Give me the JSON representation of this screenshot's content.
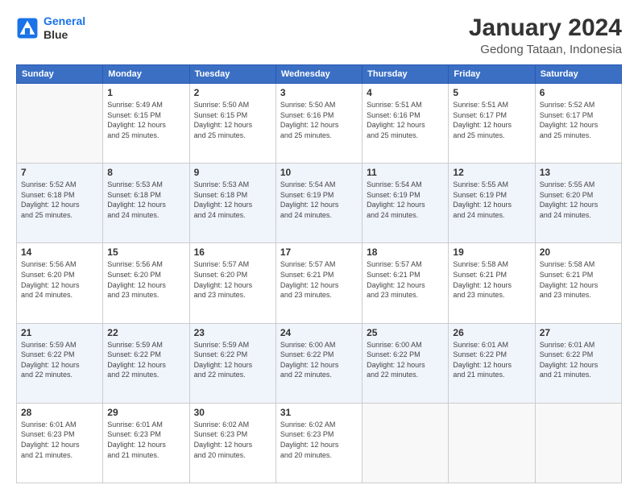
{
  "header": {
    "logo_line1": "General",
    "logo_line2": "Blue",
    "title": "January 2024",
    "subtitle": "Gedong Tataan, Indonesia"
  },
  "days_of_week": [
    "Sunday",
    "Monday",
    "Tuesday",
    "Wednesday",
    "Thursday",
    "Friday",
    "Saturday"
  ],
  "weeks": [
    [
      {
        "day": "",
        "info": ""
      },
      {
        "day": "1",
        "info": "Sunrise: 5:49 AM\nSunset: 6:15 PM\nDaylight: 12 hours\nand 25 minutes."
      },
      {
        "day": "2",
        "info": "Sunrise: 5:50 AM\nSunset: 6:15 PM\nDaylight: 12 hours\nand 25 minutes."
      },
      {
        "day": "3",
        "info": "Sunrise: 5:50 AM\nSunset: 6:16 PM\nDaylight: 12 hours\nand 25 minutes."
      },
      {
        "day": "4",
        "info": "Sunrise: 5:51 AM\nSunset: 6:16 PM\nDaylight: 12 hours\nand 25 minutes."
      },
      {
        "day": "5",
        "info": "Sunrise: 5:51 AM\nSunset: 6:17 PM\nDaylight: 12 hours\nand 25 minutes."
      },
      {
        "day": "6",
        "info": "Sunrise: 5:52 AM\nSunset: 6:17 PM\nDaylight: 12 hours\nand 25 minutes."
      }
    ],
    [
      {
        "day": "7",
        "info": "Sunrise: 5:52 AM\nSunset: 6:18 PM\nDaylight: 12 hours\nand 25 minutes."
      },
      {
        "day": "8",
        "info": "Sunrise: 5:53 AM\nSunset: 6:18 PM\nDaylight: 12 hours\nand 24 minutes."
      },
      {
        "day": "9",
        "info": "Sunrise: 5:53 AM\nSunset: 6:18 PM\nDaylight: 12 hours\nand 24 minutes."
      },
      {
        "day": "10",
        "info": "Sunrise: 5:54 AM\nSunset: 6:19 PM\nDaylight: 12 hours\nand 24 minutes."
      },
      {
        "day": "11",
        "info": "Sunrise: 5:54 AM\nSunset: 6:19 PM\nDaylight: 12 hours\nand 24 minutes."
      },
      {
        "day": "12",
        "info": "Sunrise: 5:55 AM\nSunset: 6:19 PM\nDaylight: 12 hours\nand 24 minutes."
      },
      {
        "day": "13",
        "info": "Sunrise: 5:55 AM\nSunset: 6:20 PM\nDaylight: 12 hours\nand 24 minutes."
      }
    ],
    [
      {
        "day": "14",
        "info": "Sunrise: 5:56 AM\nSunset: 6:20 PM\nDaylight: 12 hours\nand 24 minutes."
      },
      {
        "day": "15",
        "info": "Sunrise: 5:56 AM\nSunset: 6:20 PM\nDaylight: 12 hours\nand 23 minutes."
      },
      {
        "day": "16",
        "info": "Sunrise: 5:57 AM\nSunset: 6:20 PM\nDaylight: 12 hours\nand 23 minutes."
      },
      {
        "day": "17",
        "info": "Sunrise: 5:57 AM\nSunset: 6:21 PM\nDaylight: 12 hours\nand 23 minutes."
      },
      {
        "day": "18",
        "info": "Sunrise: 5:57 AM\nSunset: 6:21 PM\nDaylight: 12 hours\nand 23 minutes."
      },
      {
        "day": "19",
        "info": "Sunrise: 5:58 AM\nSunset: 6:21 PM\nDaylight: 12 hours\nand 23 minutes."
      },
      {
        "day": "20",
        "info": "Sunrise: 5:58 AM\nSunset: 6:21 PM\nDaylight: 12 hours\nand 23 minutes."
      }
    ],
    [
      {
        "day": "21",
        "info": "Sunrise: 5:59 AM\nSunset: 6:22 PM\nDaylight: 12 hours\nand 22 minutes."
      },
      {
        "day": "22",
        "info": "Sunrise: 5:59 AM\nSunset: 6:22 PM\nDaylight: 12 hours\nand 22 minutes."
      },
      {
        "day": "23",
        "info": "Sunrise: 5:59 AM\nSunset: 6:22 PM\nDaylight: 12 hours\nand 22 minutes."
      },
      {
        "day": "24",
        "info": "Sunrise: 6:00 AM\nSunset: 6:22 PM\nDaylight: 12 hours\nand 22 minutes."
      },
      {
        "day": "25",
        "info": "Sunrise: 6:00 AM\nSunset: 6:22 PM\nDaylight: 12 hours\nand 22 minutes."
      },
      {
        "day": "26",
        "info": "Sunrise: 6:01 AM\nSunset: 6:22 PM\nDaylight: 12 hours\nand 21 minutes."
      },
      {
        "day": "27",
        "info": "Sunrise: 6:01 AM\nSunset: 6:22 PM\nDaylight: 12 hours\nand 21 minutes."
      }
    ],
    [
      {
        "day": "28",
        "info": "Sunrise: 6:01 AM\nSunset: 6:23 PM\nDaylight: 12 hours\nand 21 minutes."
      },
      {
        "day": "29",
        "info": "Sunrise: 6:01 AM\nSunset: 6:23 PM\nDaylight: 12 hours\nand 21 minutes."
      },
      {
        "day": "30",
        "info": "Sunrise: 6:02 AM\nSunset: 6:23 PM\nDaylight: 12 hours\nand 20 minutes."
      },
      {
        "day": "31",
        "info": "Sunrise: 6:02 AM\nSunset: 6:23 PM\nDaylight: 12 hours\nand 20 minutes."
      },
      {
        "day": "",
        "info": ""
      },
      {
        "day": "",
        "info": ""
      },
      {
        "day": "",
        "info": ""
      }
    ]
  ]
}
